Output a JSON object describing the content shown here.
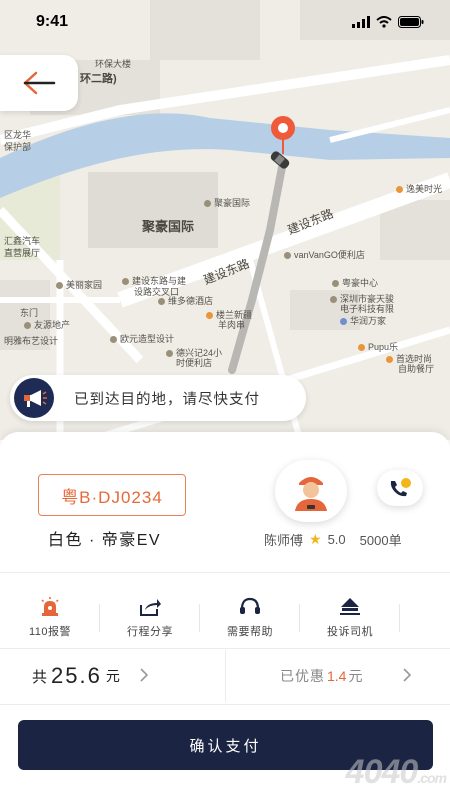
{
  "status_bar": {
    "time": "9:41"
  },
  "map": {
    "labels": {
      "huanbao": "环保大楼",
      "road_north": "环二路)",
      "district": "区龙华",
      "district2": "保护部",
      "juhao_small": "聚豪国际",
      "juhao_big": "聚豪国际",
      "jianshe_road_1": "建设东路",
      "jianshe_road_2": "建设东路",
      "yimei": "逸美时光",
      "vanvango": "vanVanGO便利店",
      "yuehao": "粤豪中心",
      "huixin": "汇鑫汽车",
      "huixin2": "直营展厅",
      "meli": "美丽家园",
      "jianshe_inter": "建设东路与建",
      "jianshe_inter2": "设路交叉口",
      "jiaotang": "维多德酒店",
      "shenzhen": "深圳市豪天骏",
      "shenzhen2": "电子科技有限",
      "huarun": "华润万家",
      "dongmen": "东门",
      "youyuan": "友源地产",
      "louna": "楼兰新疆",
      "louna2": "羊肉串",
      "pupu": "Pupu乐",
      "shouxuan": "首选时尚",
      "shouxuan2": "自助餐厅",
      "ou": "欧元造型设计",
      "mingya": "明雅布艺设计",
      "deqin": "德兴记24小",
      "deqin2": "时便利店"
    }
  },
  "arrival": {
    "text": "已到达目的地，请尽快支付"
  },
  "driver": {
    "plate": "粤B·DJ0234",
    "car_desc": "白色 · 帝豪EV",
    "name": "陈师傅",
    "rating": "5.0",
    "orders": "5000单"
  },
  "actions": [
    {
      "label": "110报警",
      "icon": "alarm-siren-icon"
    },
    {
      "label": "行程分享",
      "icon": "share-icon"
    },
    {
      "label": "需要帮助",
      "icon": "headset-icon"
    },
    {
      "label": "投诉司机",
      "icon": "complaint-icon"
    }
  ],
  "fare": {
    "prefix": "共",
    "amount": "25.6",
    "unit": "元",
    "discount_label": "已优惠",
    "discount_value": "1.4",
    "discount_unit": "元"
  },
  "pay_button": {
    "label": "确认支付"
  },
  "watermark": "4040",
  "colors": {
    "accent": "#e5663a",
    "primary_dark": "#1b2442",
    "water": "#b7cfe6",
    "route": "#b9b7b3"
  }
}
